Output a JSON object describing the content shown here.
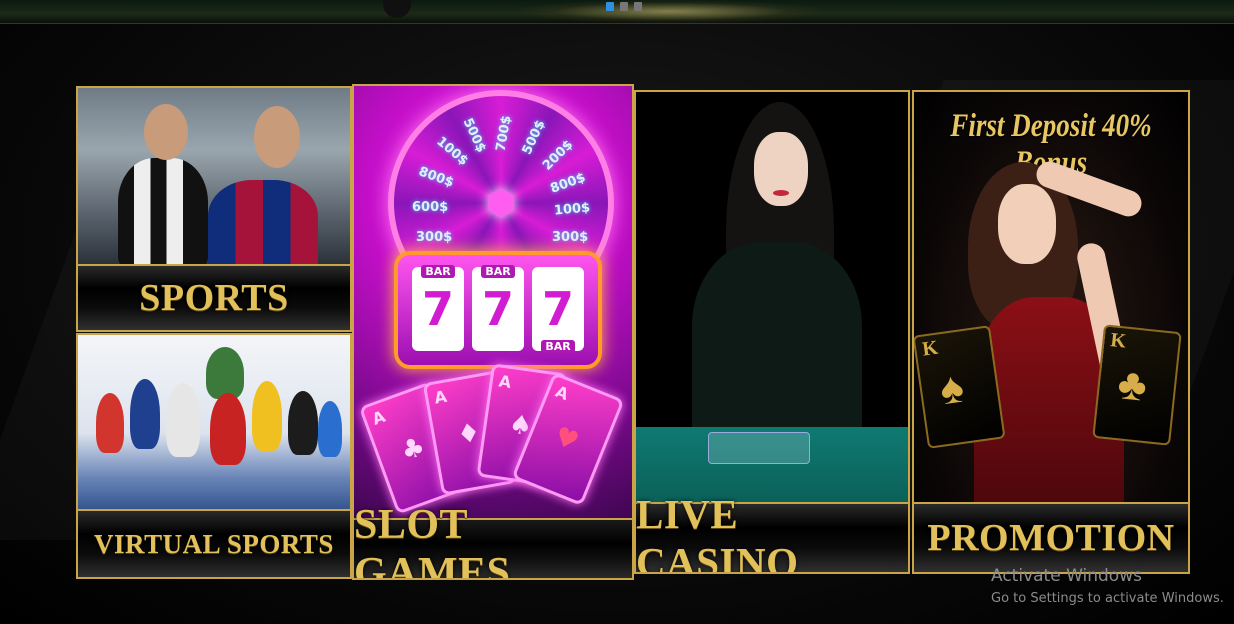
{
  "banner": {
    "slider_dots": 3,
    "active_dot": 0
  },
  "cards": {
    "sports": {
      "label": "SPORTS"
    },
    "virtual_sports": {
      "label": "VIRTUAL SPORTS"
    },
    "slot_games": {
      "label": "SLOT GAMES",
      "wheel_values": [
        "700$",
        "500$",
        "200$",
        "800$",
        "100$",
        "300$",
        "600$",
        "300$",
        "800$",
        "100$",
        "500$"
      ],
      "reel_symbol": "7",
      "reel_tag": "BAR"
    },
    "live_casino": {
      "label": "LIVE CASINO"
    },
    "promotion": {
      "label": "PROMOTION",
      "headline": "First Deposit 40% Bonus",
      "card_rank": "K"
    }
  },
  "watermark": {
    "title": "Activate Windows",
    "subtitle": "Go to Settings to activate Windows."
  },
  "colors": {
    "gold": "#c9a548",
    "label_gold": "#e2c15a",
    "accent_blue": "#2f8fe0"
  }
}
